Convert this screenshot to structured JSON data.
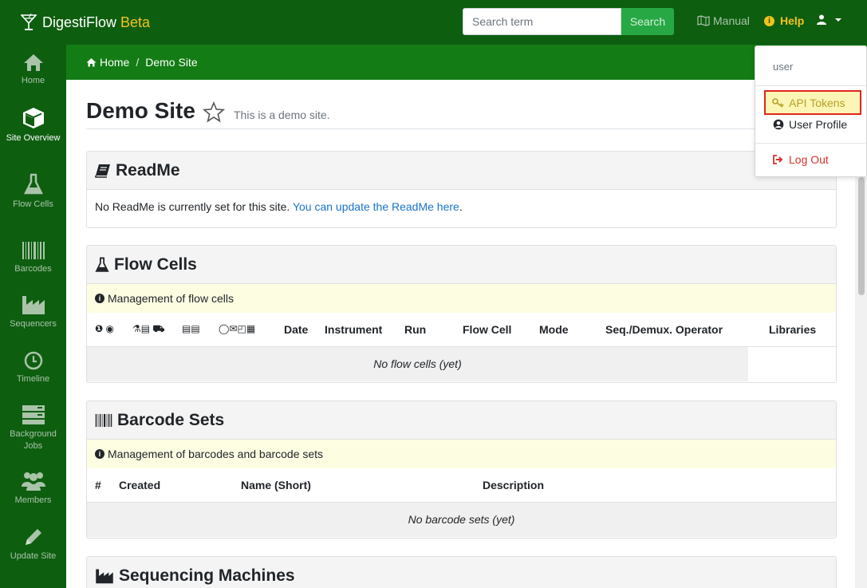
{
  "brand": {
    "name": "DigestiFlow",
    "tag": "Beta"
  },
  "search": {
    "placeholder": "Search term",
    "button": "Search"
  },
  "topnav": {
    "manual": "Manual",
    "help": "Help"
  },
  "sidebar": {
    "items": [
      {
        "label": "Home",
        "icon": "home-icon"
      },
      {
        "label": "Site Overview",
        "icon": "cube-icon",
        "active": true
      },
      {
        "label": "Flow Cells",
        "icon": "flask-icon"
      },
      {
        "label": "Barcodes",
        "icon": "barcode-icon"
      },
      {
        "label": "Sequencers",
        "icon": "industry-icon"
      },
      {
        "label": "Timeline",
        "icon": "clock-icon"
      },
      {
        "label": "Background Jobs",
        "icon": "server-icon"
      },
      {
        "label": "Members",
        "icon": "users-icon"
      },
      {
        "label": "Update Site",
        "icon": "pencil-icon"
      }
    ]
  },
  "breadcrumb": {
    "home": "Home",
    "current": "Demo Site"
  },
  "page": {
    "title": "Demo Site",
    "subtitle": "This is a demo site."
  },
  "readme": {
    "title": "ReadMe",
    "text": "No ReadMe is currently set for this site.",
    "link": "You can update the ReadMe here",
    "period": "."
  },
  "flowcells": {
    "title": "Flow Cells",
    "info": "Management of flow cells",
    "icon_groups": [
      "❶ ◉",
      "⚗▤ ⛟",
      "▤▤",
      "◯✉◰▦"
    ],
    "columns": [
      "Date",
      "Instrument",
      "Run",
      "Flow Cell",
      "Mode",
      "Seq./Demux. Operator",
      "Libraries"
    ],
    "empty": "No flow cells (yet)"
  },
  "barcodes": {
    "title": "Barcode Sets",
    "info": "Management of barcodes and barcode sets",
    "columns": [
      "#",
      "Created",
      "Name (Short)",
      "Description"
    ],
    "empty": "No barcode sets (yet)"
  },
  "machines": {
    "title": "Sequencing Machines"
  },
  "dropdown": {
    "header": "user",
    "api_tokens": "API Tokens",
    "user_profile": "User Profile",
    "log_out": "Log Out"
  },
  "colors": {
    "nav": "#0e5e10",
    "crumb": "#137c14",
    "accent": "#f4c21b",
    "search_btn": "#27a844",
    "highlight_border": "#e0261c"
  }
}
